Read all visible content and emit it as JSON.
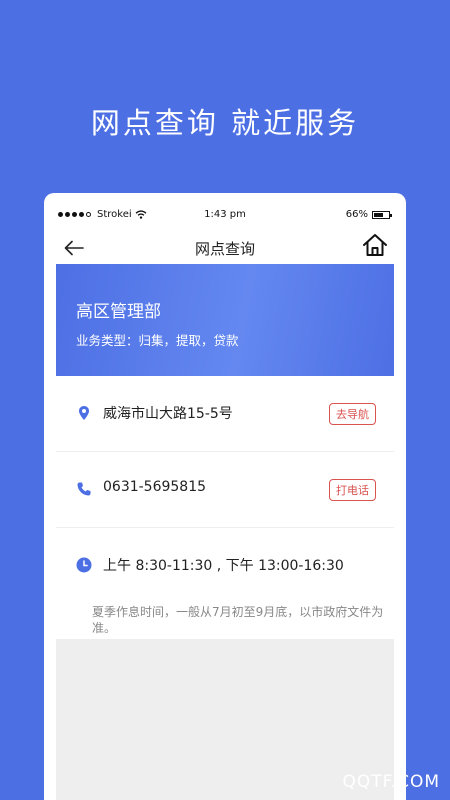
{
  "promo": {
    "headline": "网点查询  就近服务"
  },
  "status_bar": {
    "carrier": "Strokei",
    "time": "1:43 pm",
    "battery": "66%",
    "battery_level": 0.66
  },
  "nav": {
    "title": "网点查询"
  },
  "branch": {
    "name": "高区管理部",
    "business": "业务类型：归集，提取，贷款"
  },
  "address": {
    "text": "威海市山大路15-5号",
    "button": "去导航"
  },
  "phone": {
    "text": "0631-5695815",
    "button": "打电话"
  },
  "hours": {
    "text": "上午 8:30-11:30 , 下午 13:00-16:30",
    "note": "夏季作息时间，一般从7月初至9月底，以市政府文件为准。"
  },
  "watermark": "QQTF.COM",
  "colors": {
    "primary": "#4d6fe4",
    "danger": "#d9534f"
  }
}
